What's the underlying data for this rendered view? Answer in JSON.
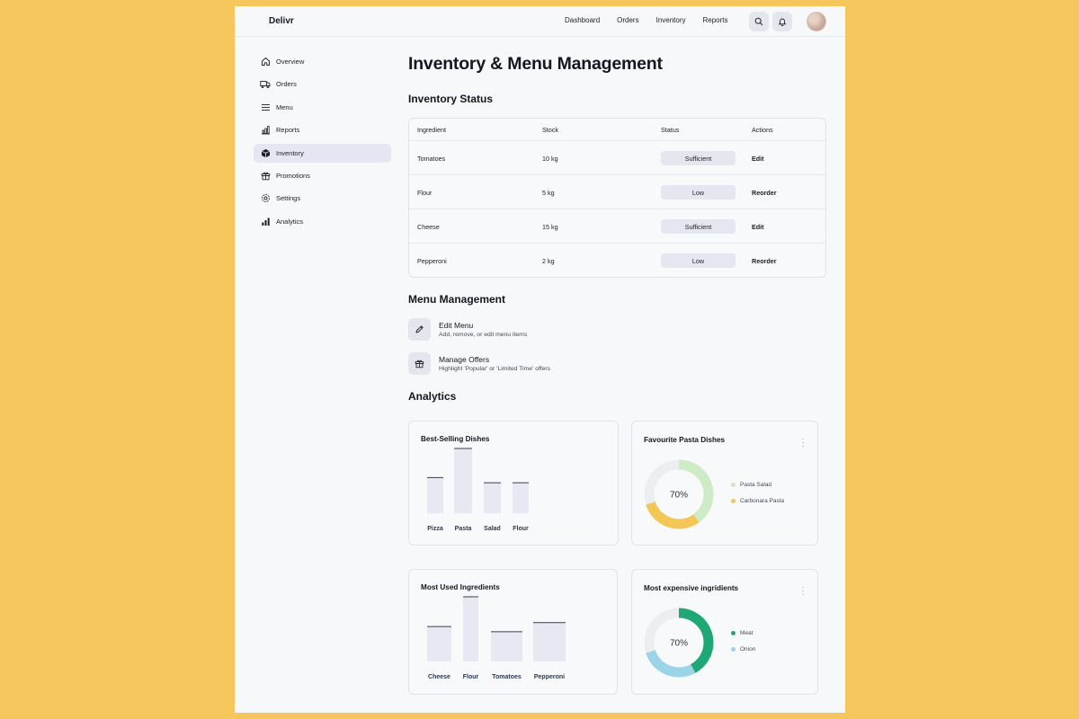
{
  "app": {
    "logo": "Delivr",
    "nav": [
      "Dashboard",
      "Orders",
      "Inventory",
      "Reports"
    ],
    "icons": {
      "search": "search-icon",
      "notifications": "bell-icon"
    }
  },
  "sidebar": {
    "items": [
      {
        "label": "Overview",
        "icon": "home-icon"
      },
      {
        "label": "Orders",
        "icon": "truck-icon"
      },
      {
        "label": "Menu",
        "icon": "menu-icon"
      },
      {
        "label": "Reports",
        "icon": "reports-icon"
      },
      {
        "label": "Inventory",
        "icon": "box-icon",
        "active": true
      },
      {
        "label": "Promotions",
        "icon": "gift-icon"
      },
      {
        "label": "Settings",
        "icon": "gear-icon"
      },
      {
        "label": "Analytics",
        "icon": "bar-chart-icon"
      }
    ]
  },
  "page": {
    "title": "Inventory & Menu Management"
  },
  "inventory": {
    "title": "Inventory Status",
    "headers": [
      "Ingredient",
      "Stock",
      "Status",
      "Actions"
    ],
    "rows": [
      {
        "ingredient": "Tomatoes",
        "stock": "10 kg",
        "status": "Sufficient",
        "action": "Edit"
      },
      {
        "ingredient": "Flour",
        "stock": "5 kg",
        "status": "Low",
        "action": "Reorder"
      },
      {
        "ingredient": "Cheese",
        "stock": "15 kg",
        "status": "Sufficient",
        "action": "Edit"
      },
      {
        "ingredient": "Pepperoni",
        "stock": "2 kg",
        "status": "Low",
        "action": "Reorder"
      }
    ]
  },
  "menu_management": {
    "title": "Menu Management",
    "items": [
      {
        "title": "Edit Menu",
        "subtitle": "Add, remove, or edit menu items",
        "icon": "pencil-icon"
      },
      {
        "title": "Manage Offers",
        "subtitle": "Highlight 'Popular' or 'Limited Time' offers",
        "icon": "gift-icon"
      }
    ]
  },
  "analytics": {
    "title": "Analytics"
  },
  "colors": {
    "bar_fill": "#E6E8F2",
    "bar_top": "#3A3F4B",
    "pasta_salad": "#CDEBC4",
    "carbonara": "#F4C655",
    "meat": "#1FA776",
    "onion": "#9BD4E6",
    "ring_track": "#ECEEF1"
  },
  "chart_data": [
    {
      "type": "bar",
      "title": "Best-Selling Dishes",
      "categories": [
        "Pizza",
        "Pasta",
        "Salad",
        "Flour"
      ],
      "values": [
        55,
        100,
        47,
        47
      ],
      "ylim": [
        0,
        100
      ],
      "grid": false
    },
    {
      "type": "pie",
      "title": "Favourite Pasta Dishes",
      "center_label": "70%",
      "labels": [
        "Pasta Salad",
        "Carbonara Pasta"
      ],
      "values": [
        40,
        30
      ],
      "legend": "right"
    },
    {
      "type": "bar",
      "title": "Most Used Ingredients",
      "categories": [
        "Cheese",
        "Flour",
        "Tomatoes",
        "Pepperoni"
      ],
      "values": [
        54,
        100,
        46,
        60
      ],
      "ylim": [
        0,
        100
      ],
      "grid": false
    },
    {
      "type": "pie",
      "title": "Most expensive ingridients",
      "center_label": "70%",
      "labels": [
        "Meat",
        "Onion"
      ],
      "values": [
        42,
        28
      ],
      "legend": "right"
    }
  ]
}
